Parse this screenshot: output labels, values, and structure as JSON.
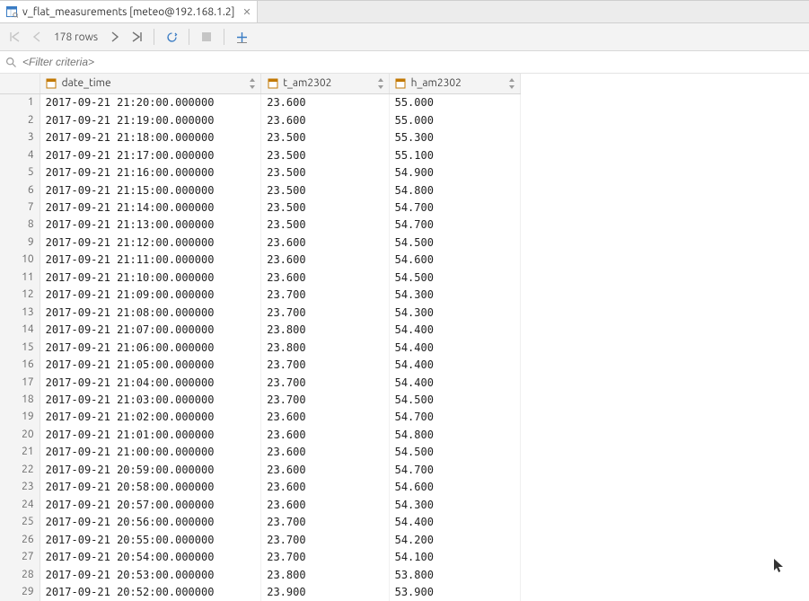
{
  "tab": {
    "title": "v_flat_measurements [meteo@192.168.1.2]"
  },
  "toolbar": {
    "row_count": "178 rows"
  },
  "filter": {
    "placeholder": "<Filter criteria>"
  },
  "columns": [
    {
      "name": "date_time"
    },
    {
      "name": "t_am2302"
    },
    {
      "name": "h_am2302"
    }
  ],
  "rows": [
    {
      "date_time": "2017-09-21 21:20:00.000000",
      "t": "23.600",
      "h": "55.000"
    },
    {
      "date_time": "2017-09-21 21:19:00.000000",
      "t": "23.600",
      "h": "55.000"
    },
    {
      "date_time": "2017-09-21 21:18:00.000000",
      "t": "23.500",
      "h": "55.300"
    },
    {
      "date_time": "2017-09-21 21:17:00.000000",
      "t": "23.500",
      "h": "55.100"
    },
    {
      "date_time": "2017-09-21 21:16:00.000000",
      "t": "23.500",
      "h": "54.900"
    },
    {
      "date_time": "2017-09-21 21:15:00.000000",
      "t": "23.500",
      "h": "54.800"
    },
    {
      "date_time": "2017-09-21 21:14:00.000000",
      "t": "23.500",
      "h": "54.700"
    },
    {
      "date_time": "2017-09-21 21:13:00.000000",
      "t": "23.500",
      "h": "54.700"
    },
    {
      "date_time": "2017-09-21 21:12:00.000000",
      "t": "23.600",
      "h": "54.500"
    },
    {
      "date_time": "2017-09-21 21:11:00.000000",
      "t": "23.600",
      "h": "54.600"
    },
    {
      "date_time": "2017-09-21 21:10:00.000000",
      "t": "23.600",
      "h": "54.500"
    },
    {
      "date_time": "2017-09-21 21:09:00.000000",
      "t": "23.700",
      "h": "54.300"
    },
    {
      "date_time": "2017-09-21 21:08:00.000000",
      "t": "23.700",
      "h": "54.300"
    },
    {
      "date_time": "2017-09-21 21:07:00.000000",
      "t": "23.800",
      "h": "54.400"
    },
    {
      "date_time": "2017-09-21 21:06:00.000000",
      "t": "23.800",
      "h": "54.400"
    },
    {
      "date_time": "2017-09-21 21:05:00.000000",
      "t": "23.700",
      "h": "54.400"
    },
    {
      "date_time": "2017-09-21 21:04:00.000000",
      "t": "23.700",
      "h": "54.400"
    },
    {
      "date_time": "2017-09-21 21:03:00.000000",
      "t": "23.700",
      "h": "54.500"
    },
    {
      "date_time": "2017-09-21 21:02:00.000000",
      "t": "23.600",
      "h": "54.700"
    },
    {
      "date_time": "2017-09-21 21:01:00.000000",
      "t": "23.600",
      "h": "54.800"
    },
    {
      "date_time": "2017-09-21 21:00:00.000000",
      "t": "23.600",
      "h": "54.500"
    },
    {
      "date_time": "2017-09-21 20:59:00.000000",
      "t": "23.600",
      "h": "54.700"
    },
    {
      "date_time": "2017-09-21 20:58:00.000000",
      "t": "23.600",
      "h": "54.600"
    },
    {
      "date_time": "2017-09-21 20:57:00.000000",
      "t": "23.600",
      "h": "54.300"
    },
    {
      "date_time": "2017-09-21 20:56:00.000000",
      "t": "23.700",
      "h": "54.400"
    },
    {
      "date_time": "2017-09-21 20:55:00.000000",
      "t": "23.700",
      "h": "54.200"
    },
    {
      "date_time": "2017-09-21 20:54:00.000000",
      "t": "23.700",
      "h": "54.100"
    },
    {
      "date_time": "2017-09-21 20:53:00.000000",
      "t": "23.800",
      "h": "53.800"
    },
    {
      "date_time": "2017-09-21 20:52:00.000000",
      "t": "23.900",
      "h": "53.900"
    }
  ]
}
